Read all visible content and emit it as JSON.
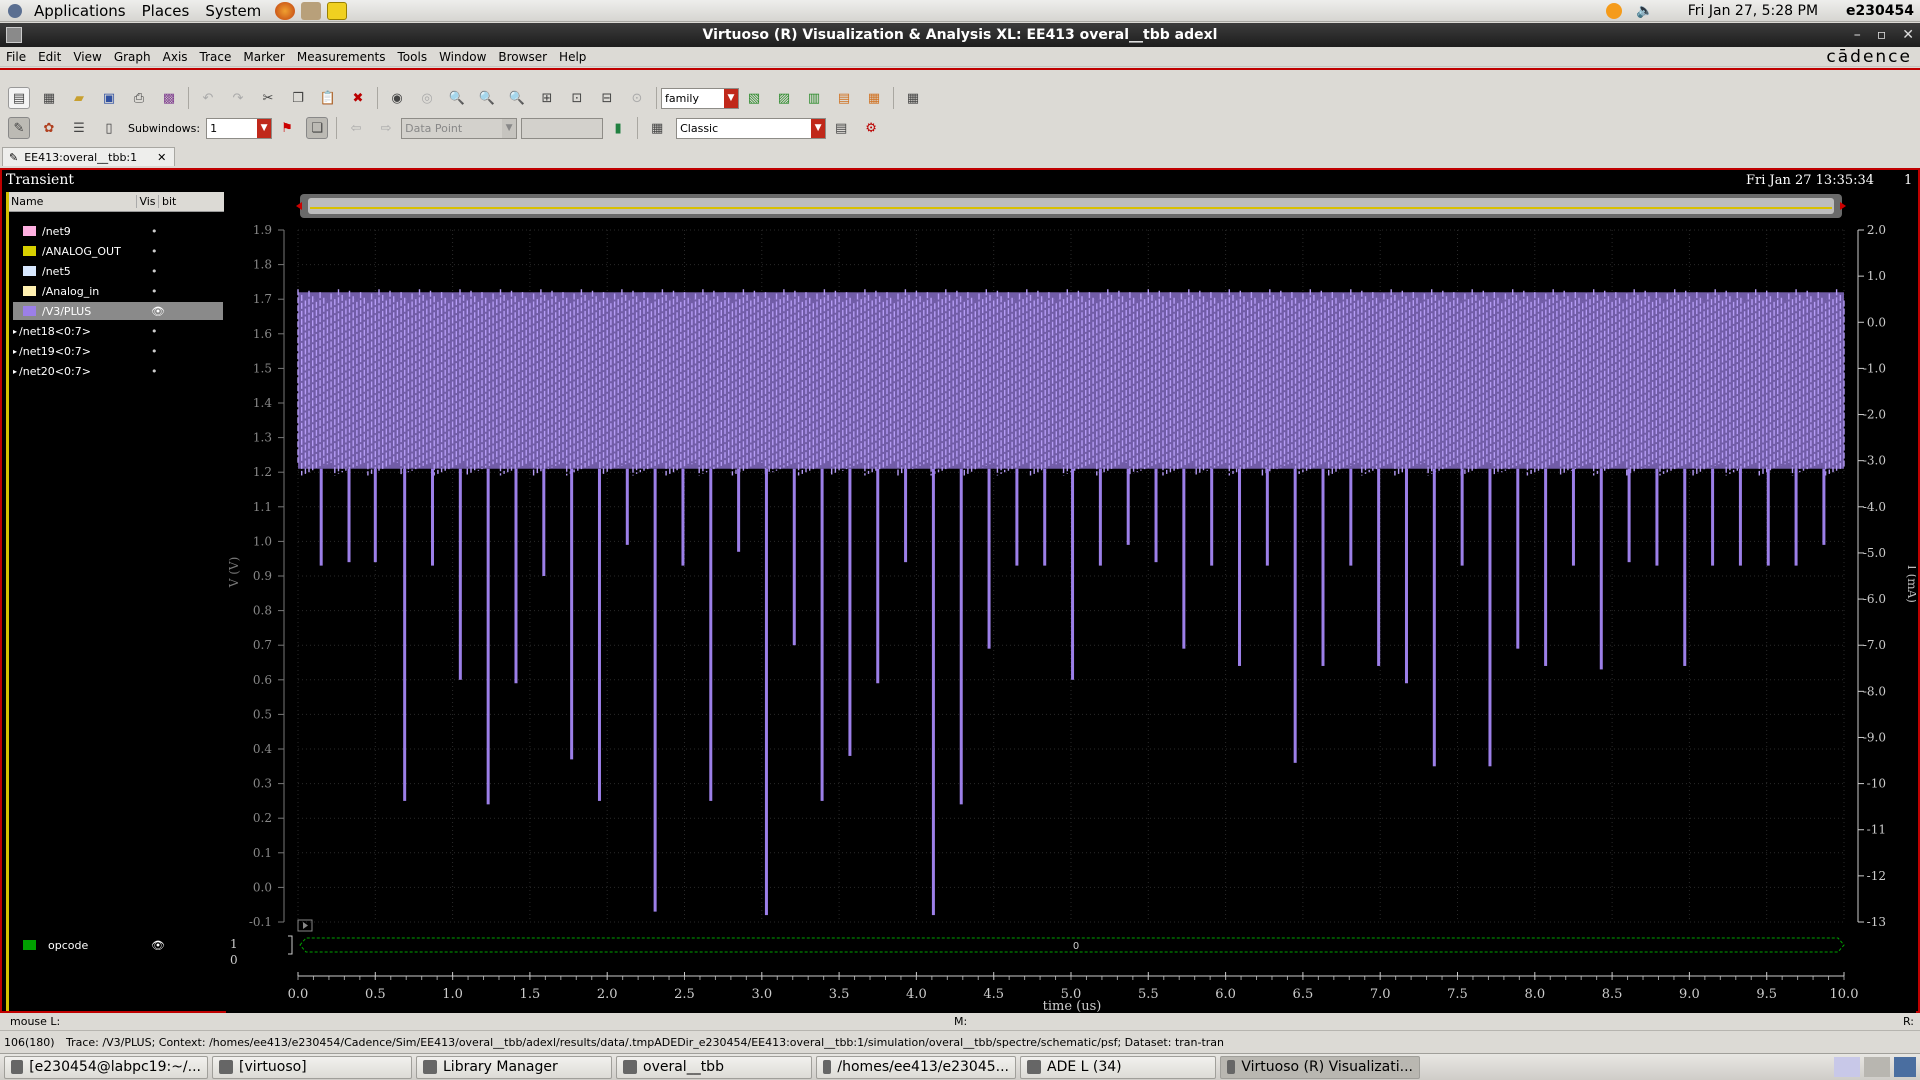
{
  "top_panel": {
    "menus": [
      "Applications",
      "Places",
      "System"
    ],
    "clock": "Fri Jan 27,  5:28 PM",
    "user": "e230454"
  },
  "window": {
    "title": "Virtuoso (R) Visualization & Analysis XL: EE413 overal__tbb adexl",
    "brand": "cādence"
  },
  "menubar": [
    "File",
    "Edit",
    "View",
    "Graph",
    "Axis",
    "Trace",
    "Marker",
    "Measurements",
    "Tools",
    "Window",
    "Browser",
    "Help"
  ],
  "toolbar1": {
    "family_combo": "family"
  },
  "toolbar2": {
    "subwindows_label": "Subwindows:",
    "subwindows_value": "1",
    "data_point_combo": "Data Point",
    "style_combo": "Classic"
  },
  "doc_tab": {
    "label": "EE413:overal__tbb:1"
  },
  "graph": {
    "analysis": "Transient",
    "timestamp": "Fri Jan 27 13:35:34",
    "subwindow_index": "1",
    "left_axis_label": "V (V)",
    "right_axis_label": "I (mA)",
    "x_axis_label": "time (us)",
    "digital_hi": "1",
    "digital_lo": "0",
    "digital_bus_value": "0"
  },
  "legend": {
    "headers": [
      "Name",
      "Vis",
      "bit"
    ],
    "items": [
      {
        "name": "/net9",
        "color": "#ffb0e0"
      },
      {
        "name": "/ANALOG_OUT",
        "color": "#d8d000"
      },
      {
        "name": "/net5",
        "color": "#d8e8ff"
      },
      {
        "name": "/Analog_in",
        "color": "#fff0b0"
      },
      {
        "name": "/V3/PLUS",
        "color": "#9c7fe8",
        "selected": true
      },
      {
        "name": "/net18<0:7>",
        "bus": true
      },
      {
        "name": "/net19<0:7>",
        "bus": true
      },
      {
        "name": "/net20<0:7>",
        "bus": true
      }
    ],
    "digital_item": {
      "name": "opcode",
      "color": "#00a000"
    }
  },
  "chart_data": {
    "type": "line",
    "title": "Transient",
    "xlabel": "time (us)",
    "ylabel": "V (V)",
    "y2label": "I (mA)",
    "xlim": [
      0,
      10
    ],
    "ylim": [
      -0.1,
      1.9
    ],
    "y2lim": [
      -13,
      2
    ],
    "x_ticks": [
      "0.0",
      "0.5",
      "1.0",
      "1.5",
      "2.0",
      "2.5",
      "3.0",
      "3.5",
      "4.0",
      "4.5",
      "5.0",
      "5.5",
      "6.0",
      "6.5",
      "7.0",
      "7.5",
      "8.0",
      "8.5",
      "9.0",
      "9.5",
      "10.0"
    ],
    "y_ticks": [
      "1.9",
      "1.8",
      "1.7",
      "1.6",
      "1.5",
      "1.4",
      "1.3",
      "1.2",
      "1.1",
      "1.0",
      "0.9",
      "0.8",
      "0.7",
      "0.6",
      "0.5",
      "0.4",
      "0.3",
      "0.2",
      "0.1",
      "0.0",
      "-0.1"
    ],
    "y2_ticks": [
      "2.0",
      "1.0",
      "0.0",
      "-1.0",
      "-2.0",
      "-3.0",
      "-4.0",
      "-5.0",
      "-6.0",
      "-7.0",
      "-8.0",
      "-9.0",
      "-10",
      "-11",
      "-12",
      "-13"
    ],
    "grid": true,
    "series": [
      {
        "name": "/V3/PLUS",
        "color": "#9c7fe8",
        "band_top": 1.72,
        "band_bottom": 1.21,
        "spikes": [
          {
            "x": 0.15,
            "y": 0.93
          },
          {
            "x": 0.33,
            "y": 0.94
          },
          {
            "x": 0.5,
            "y": 0.94
          },
          {
            "x": 0.69,
            "y": 0.25
          },
          {
            "x": 0.87,
            "y": 0.93
          },
          {
            "x": 1.05,
            "y": 0.6
          },
          {
            "x": 1.23,
            "y": 0.24
          },
          {
            "x": 1.41,
            "y": 0.59
          },
          {
            "x": 1.59,
            "y": 0.9
          },
          {
            "x": 1.77,
            "y": 0.37
          },
          {
            "x": 1.95,
            "y": 0.25
          },
          {
            "x": 2.13,
            "y": 0.99
          },
          {
            "x": 2.31,
            "y": -0.07
          },
          {
            "x": 2.49,
            "y": 0.93
          },
          {
            "x": 2.67,
            "y": 0.25
          },
          {
            "x": 2.85,
            "y": 0.97
          },
          {
            "x": 3.03,
            "y": -0.08
          },
          {
            "x": 3.21,
            "y": 0.7
          },
          {
            "x": 3.39,
            "y": 0.25
          },
          {
            "x": 3.57,
            "y": 0.38
          },
          {
            "x": 3.75,
            "y": 0.59
          },
          {
            "x": 3.93,
            "y": 0.94
          },
          {
            "x": 4.11,
            "y": -0.08
          },
          {
            "x": 4.29,
            "y": 0.24
          },
          {
            "x": 4.47,
            "y": 0.69
          },
          {
            "x": 4.65,
            "y": 0.93
          },
          {
            "x": 4.83,
            "y": 0.93
          },
          {
            "x": 5.01,
            "y": 0.6
          },
          {
            "x": 5.19,
            "y": 0.93
          },
          {
            "x": 5.37,
            "y": 0.99
          },
          {
            "x": 5.55,
            "y": 0.94
          },
          {
            "x": 5.73,
            "y": 0.69
          },
          {
            "x": 5.91,
            "y": 0.93
          },
          {
            "x": 6.09,
            "y": 0.64
          },
          {
            "x": 6.27,
            "y": 0.93
          },
          {
            "x": 6.45,
            "y": 0.36
          },
          {
            "x": 6.63,
            "y": 0.64
          },
          {
            "x": 6.81,
            "y": 0.93
          },
          {
            "x": 6.99,
            "y": 0.64
          },
          {
            "x": 7.17,
            "y": 0.59
          },
          {
            "x": 7.35,
            "y": 0.35
          },
          {
            "x": 7.53,
            "y": 0.93
          },
          {
            "x": 7.71,
            "y": 0.35
          },
          {
            "x": 7.89,
            "y": 0.69
          },
          {
            "x": 8.07,
            "y": 0.64
          },
          {
            "x": 8.25,
            "y": 0.93
          },
          {
            "x": 8.43,
            "y": 0.63
          },
          {
            "x": 8.61,
            "y": 0.94
          },
          {
            "x": 8.79,
            "y": 0.93
          },
          {
            "x": 8.97,
            "y": 0.64
          },
          {
            "x": 9.15,
            "y": 0.93
          },
          {
            "x": 9.33,
            "y": 0.93
          },
          {
            "x": 9.51,
            "y": 0.93
          },
          {
            "x": 9.69,
            "y": 0.93
          },
          {
            "x": 9.87,
            "y": 0.99
          }
        ]
      }
    ]
  },
  "status": {
    "mouse_l": "mouse L:",
    "mouse_m": "M:",
    "mouse_r": "R:",
    "counter": "106(180)",
    "trace_info": "Trace: /V3/PLUS; Context: /homes/ee413/e230454/Cadence/Sim/EE413/overal__tbb/adexl/results/data/.tmpADEDir_e230454/EE413:overal__tbb:1/simulation/overal__tbb/spectre/schematic/psf; Dataset: tran-tran"
  },
  "taskbar": [
    {
      "label": "[e230454@labpc19:~/..."
    },
    {
      "label": "[virtuoso]"
    },
    {
      "label": "Library Manager"
    },
    {
      "label": "overal__tbb"
    },
    {
      "label": "/homes/ee413/e23045..."
    },
    {
      "label": "ADE L (34)"
    },
    {
      "label": "Virtuoso (R) Visualizati...",
      "active": true
    }
  ]
}
